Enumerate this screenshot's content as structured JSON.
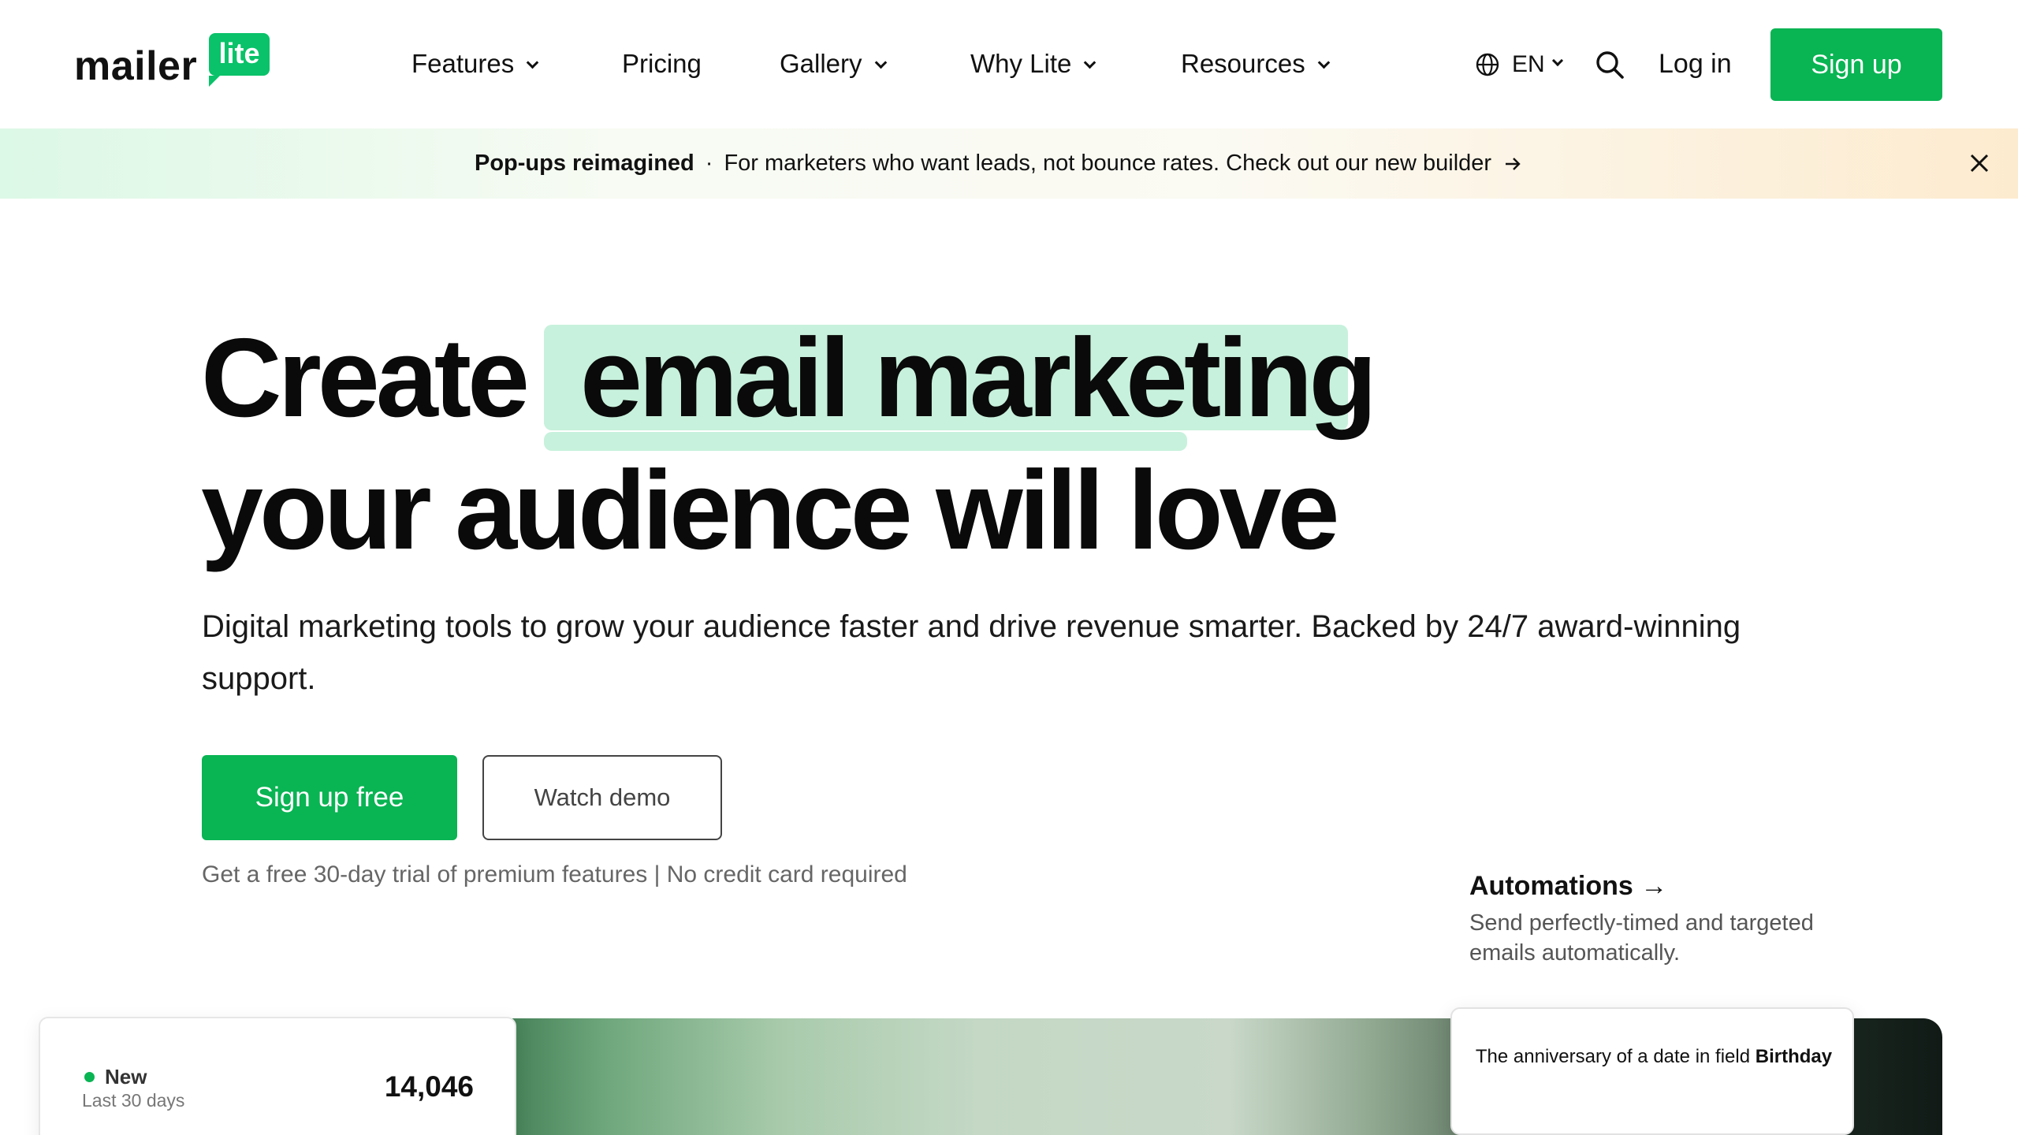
{
  "brand": {
    "name": "mailer",
    "badge": "lite",
    "badge_color": "#09c269"
  },
  "nav": {
    "items": [
      {
        "label": "Features",
        "dropdown": true
      },
      {
        "label": "Pricing",
        "dropdown": false
      },
      {
        "label": "Gallery",
        "dropdown": true
      },
      {
        "label": "Why Lite",
        "dropdown": true
      },
      {
        "label": "Resources",
        "dropdown": true
      }
    ],
    "language": "EN",
    "login_label": "Log in",
    "signup_label": "Sign up",
    "accent_color": "#09b453"
  },
  "banner": {
    "title": "Pop-ups reimagined",
    "separator": "·",
    "message": "For marketers who want leads, not bounce rates. Check out our new builder"
  },
  "hero": {
    "title_word1": "Create",
    "title_highlight": "email marketing",
    "title_line2": "your audience will love",
    "highlight_color": "#c7f1dc",
    "subtitle": "Digital marketing tools to grow your audience faster and drive revenue smarter. Backed by 24/7 award-winning support.",
    "primary_cta": "Sign up free",
    "secondary_cta": "Watch demo",
    "trial_note": "Get a free 30-day trial of premium features | No credit card required"
  },
  "feature": {
    "title": "Automations →",
    "description": "Send perfectly-timed and targeted emails automatically."
  },
  "stat_card": {
    "label": "New",
    "period": "Last 30 days",
    "value": "14,046"
  },
  "trigger_card": {
    "text": "The anniversary of a date in field",
    "field": "Birthday"
  }
}
